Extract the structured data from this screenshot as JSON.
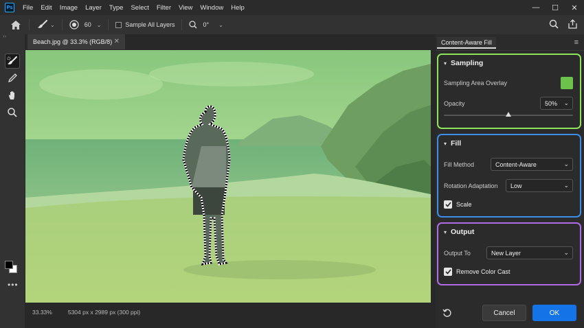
{
  "app": {
    "logo_text": "Ps",
    "menu": [
      "File",
      "Edit",
      "Image",
      "Layer",
      "Type",
      "Select",
      "Filter",
      "View",
      "Window",
      "Help"
    ],
    "window_controls": {
      "minimize": "—",
      "maximize": "☐",
      "close": "✕"
    }
  },
  "options": {
    "brush_size": "60",
    "sample_all_layers_label": "Sample All Layers",
    "angle": "0°"
  },
  "document": {
    "tab_title": "Beach.jpg @ 33.3% (RGB/8)",
    "close_glyph": "✕",
    "zoom_status": "33.33%",
    "dimensions_status": "5304 px x 2989 px (300 ppi)"
  },
  "panel": {
    "title": "Content-Aware Fill",
    "sampling": {
      "heading": "Sampling",
      "overlay_label": "Sampling Area Overlay",
      "overlay_color": "#6cc24a",
      "opacity_label": "Opacity",
      "opacity_value": "50%",
      "opacity_fraction": 0.5,
      "border_color": "#8ee65a"
    },
    "fill": {
      "heading": "Fill",
      "method_label": "Fill Method",
      "method_value": "Content-Aware",
      "rotation_label": "Rotation Adaptation",
      "rotation_value": "Low",
      "scale_label": "Scale",
      "border_color": "#3d8ee6"
    },
    "output": {
      "heading": "Output",
      "output_to_label": "Output To",
      "output_to_value": "New Layer",
      "remove_cast_label": "Remove Color Cast",
      "border_color": "#b36be6"
    },
    "cancel_label": "Cancel",
    "ok_label": "OK",
    "ok_color": "#1473e6"
  }
}
